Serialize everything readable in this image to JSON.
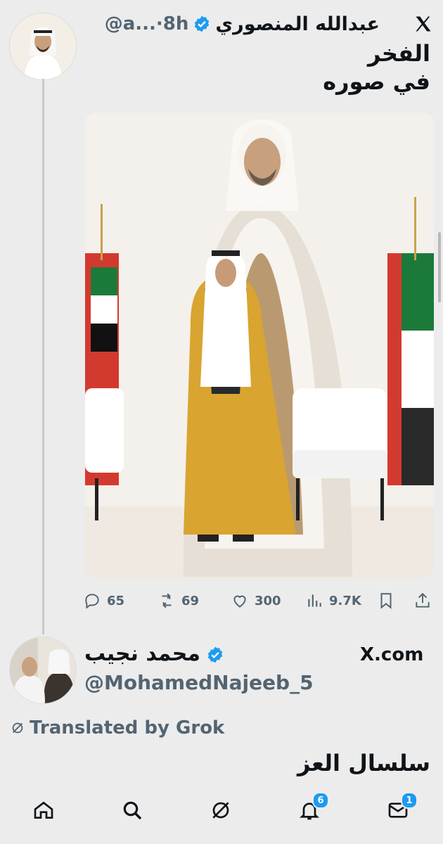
{
  "tweet1": {
    "display_name": "عبدالله المنصوري",
    "handle_time": "@a...·8h",
    "text_line1": "الفخر",
    "text_line2": "في صوره"
  },
  "actions": {
    "replies": "65",
    "reposts": "69",
    "likes": "300",
    "views": "9.7K"
  },
  "tweet2": {
    "display_name": "محمد نجيب",
    "handle": "@MohamedNajeeb_5",
    "source_label": "X.com",
    "translated_label": "Translated by Grok",
    "text": "سلسال العز"
  },
  "tabbar": {
    "notifications_badge": "6",
    "messages_badge": "1"
  },
  "colors": {
    "verified": "#1d9bf0",
    "secondary_text": "#536471",
    "background": "#ececec"
  },
  "icons": [
    "x-logo-icon",
    "reply-icon",
    "repost-icon",
    "like-icon",
    "views-icon",
    "bookmark-icon",
    "share-icon",
    "grok-icon",
    "home-icon",
    "search-icon",
    "notifications-icon",
    "messages-icon"
  ]
}
